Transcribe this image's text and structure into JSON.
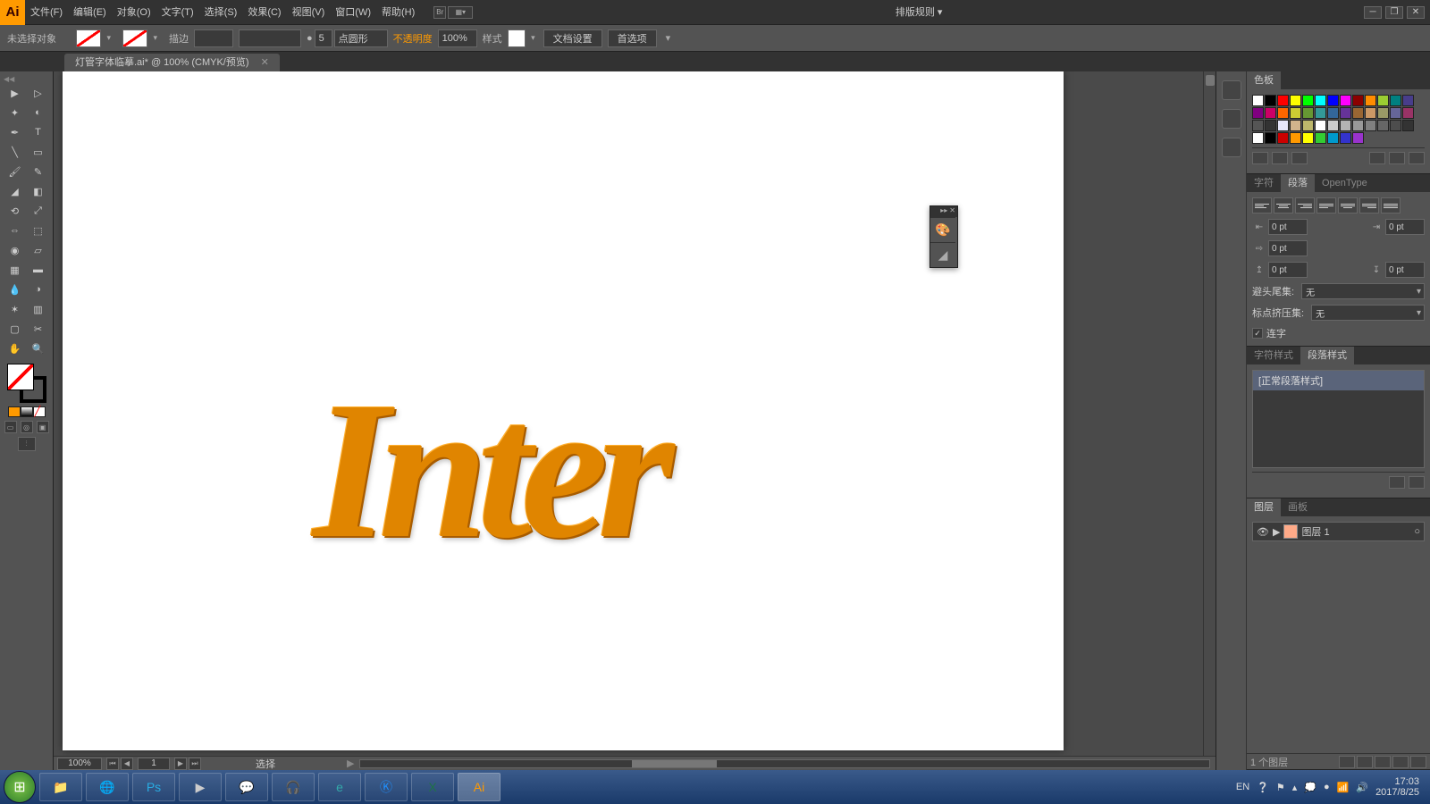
{
  "menu": {
    "layout_rules": "排版规则",
    "items": [
      "文件(F)",
      "编辑(E)",
      "对象(O)",
      "文字(T)",
      "选择(S)",
      "效果(C)",
      "视图(V)",
      "窗口(W)",
      "帮助(H)"
    ]
  },
  "controlbar": {
    "selection": "未选择对象",
    "stroke_label": "描边",
    "stroke_pt": "5",
    "stroke_profile": "点圆形",
    "opacity_label": "不透明度",
    "opacity": "100%",
    "style_label": "样式",
    "doc_setup": "文档设置",
    "prefs": "首选项"
  },
  "doc_tab": "灯管字体临摹.ai* @ 100% (CMYK/预览)",
  "canvas_text": "Inter",
  "status": {
    "zoom": "100%",
    "page": "1",
    "tool": "选择"
  },
  "swatch_panel": {
    "title": "色板",
    "row1": [
      "#ffffff",
      "#000000",
      "#ff0000",
      "#ffff00",
      "#00ff00",
      "#00ffff",
      "#0000ff",
      "#ff00ff",
      "#8b0000",
      "#ff8c00",
      "#9acd32",
      "#008080",
      "#483d8b",
      "#800080"
    ],
    "row2": [
      "#cc0066",
      "#ff6600",
      "#cccc33",
      "#669933",
      "#339999",
      "#336699",
      "#663399",
      "#996633",
      "#cc9966",
      "#999966",
      "#666699",
      "#993366",
      "#555555",
      "#333333"
    ],
    "row3": [
      "#e6e6fa",
      "#d2b48c",
      "#bdb76b",
      "#ffffff",
      "#cccccc",
      "#b3b3b3",
      "#999999",
      "#808080",
      "#666666",
      "#4d4d4d",
      "#333333",
      "#ffffff"
    ],
    "row4": [
      "#000000",
      "#cc0000",
      "#ff9900",
      "#ffff00",
      "#33cc33",
      "#0099cc",
      "#3333cc",
      "#9933cc"
    ]
  },
  "para_panel": {
    "tabs": [
      "字符",
      "段落",
      "OpenType"
    ],
    "active": 1,
    "indent_left": "0 pt",
    "indent_right": "0 pt",
    "first_line": "0 pt",
    "space_before": "0 pt",
    "space_after": "0 pt",
    "hyphen_head": "避头尾集:",
    "hyphen_val": "无",
    "kinsoku_head": "标点挤压集:",
    "kinsoku_val": "无",
    "ligature": "连字",
    "ligature_on": true
  },
  "styles_panel": {
    "tabs": [
      "字符样式",
      "段落样式"
    ],
    "active": 1,
    "item": "[正常段落样式]"
  },
  "layers_panel": {
    "tabs": [
      "图层",
      "画板"
    ],
    "active": 0,
    "layer": "图层 1",
    "count": "1 个图层"
  },
  "taskbar": {
    "lang": "EN",
    "time": "17:03",
    "date": "2017/8/25"
  }
}
